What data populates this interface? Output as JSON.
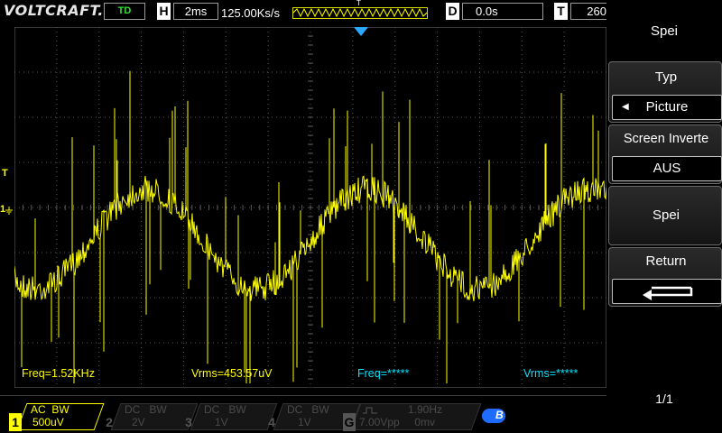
{
  "topbar": {
    "brand": "VOLTCRAFT.",
    "mode": "TD",
    "h_letter": "H",
    "timebase": "2ms",
    "sample_rate": "125.00Ks/s",
    "trigger_marker": "T",
    "d_letter": "D",
    "delay": "0.0s",
    "t_letter": "T",
    "trigger_level": "260"
  },
  "scope": {
    "trace_color": "#ffff00",
    "grid_color": "#5a5a5a",
    "ch1_marker": "1",
    "trig_marker": "T"
  },
  "measurements": [
    {
      "label": "Freq=1.52KHz",
      "color": "#ffff00"
    },
    {
      "label": "Vrms=453.57uV",
      "color": "#ffff00"
    },
    {
      "label": "Freq=*****",
      "color": "#00e5ff"
    },
    {
      "label": "Vrms=*****",
      "color": "#00e5ff"
    }
  ],
  "menu": {
    "title": "Spei",
    "type_label": "Typ",
    "type_value": "Picture",
    "invert_label": "Screen Inverte",
    "invert_value": "AUS",
    "save_label": "Spei",
    "return_label": "Return",
    "page": "1/1"
  },
  "channels": [
    {
      "num": "1",
      "coupling": "AC",
      "bw": "BW",
      "scale": "500uV",
      "active": true
    },
    {
      "num": "2",
      "coupling": "DC",
      "bw": "BW",
      "scale": "2V",
      "active": false
    },
    {
      "num": "3",
      "coupling": "DC",
      "bw": "BW",
      "scale": "1V",
      "active": false
    },
    {
      "num": "4",
      "coupling": "DC",
      "bw": "BW",
      "scale": "1V",
      "active": false
    }
  ],
  "gen": {
    "letter": "G",
    "freq": "1.90Hz",
    "amplitude": "7.00Vpp",
    "offset": "0mv"
  },
  "bluetooth": {
    "icon": "bluetooth-icon",
    "color": "#1e6cff",
    "label": "B"
  }
}
